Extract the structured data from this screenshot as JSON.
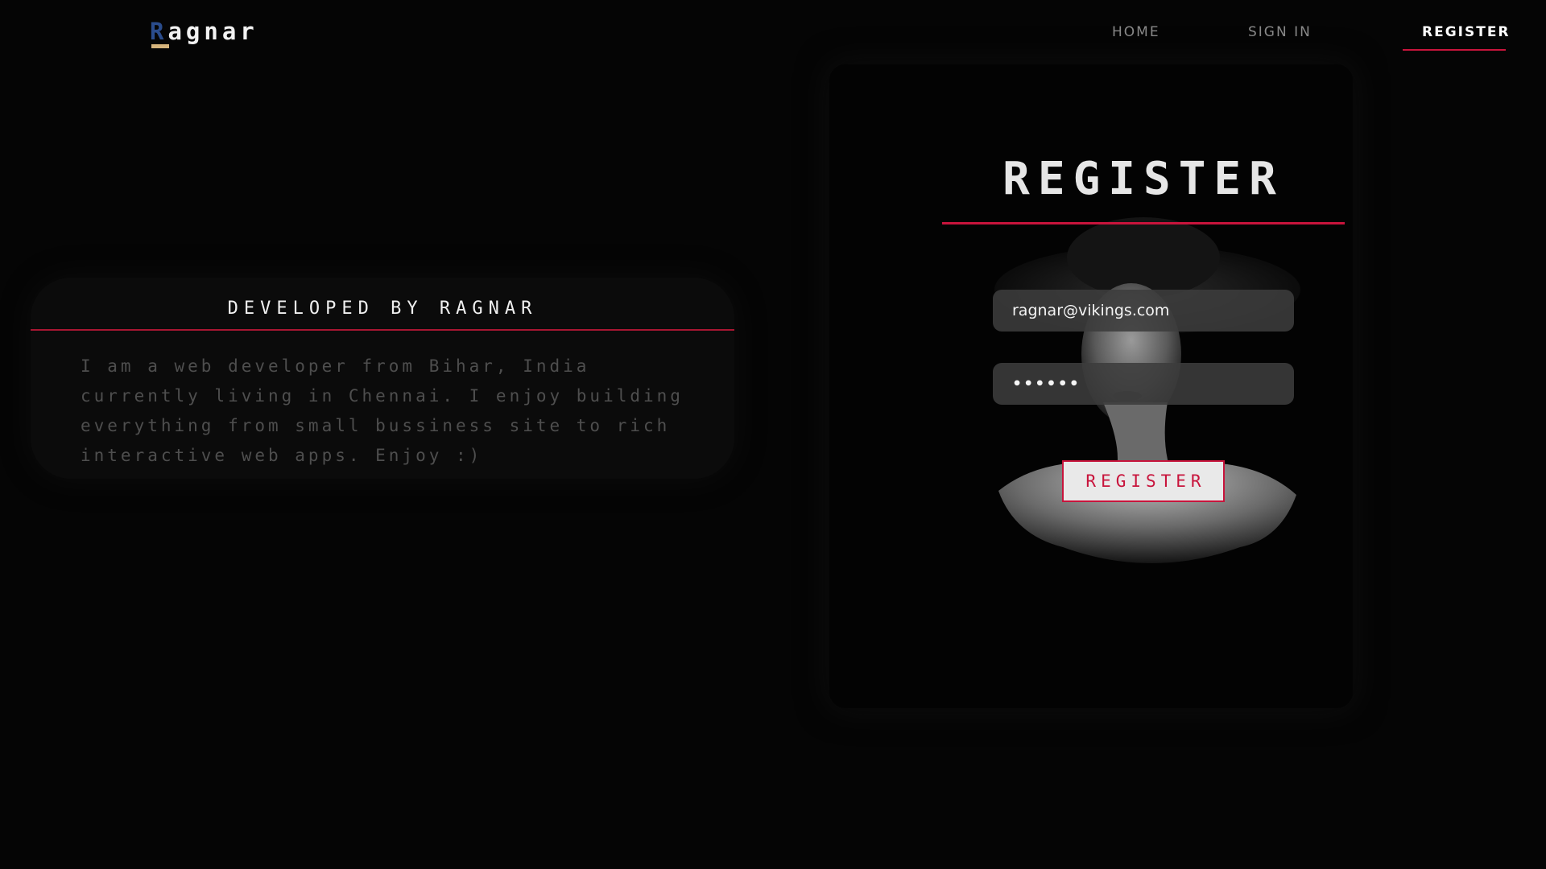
{
  "nav": {
    "logo_first_letter": "R",
    "logo_rest": "agnar",
    "links": [
      {
        "label": "HOME"
      },
      {
        "label": "SIGN IN"
      },
      {
        "label": "REGISTER"
      }
    ],
    "active": "REGISTER"
  },
  "about": {
    "title": "DEVELOPED BY RAGNAR",
    "text": "I am a web developer from Bihar, India currently living in Chennai. I enjoy building everything from small bussiness site to rich interactive web apps. Enjoy :)"
  },
  "register": {
    "heading": "REGISTER",
    "email_value": "ragnar@vikings.com",
    "password_value": "••••••",
    "button_label": "REGISTER"
  },
  "colors": {
    "background": "#050505",
    "accent": "#c8143c",
    "logo_letter": "#2a4c8c",
    "logo_underline": "#d6b47c"
  }
}
